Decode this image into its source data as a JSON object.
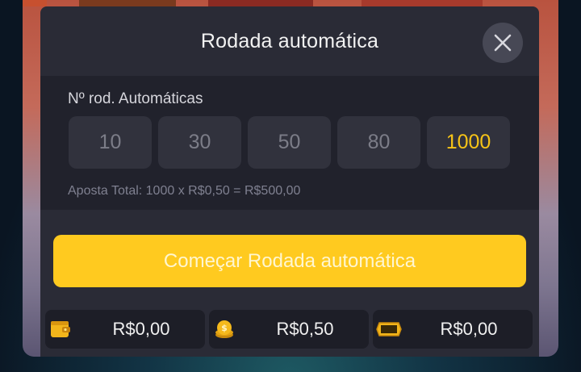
{
  "modal": {
    "title": "Rodada automática",
    "close_icon": "close-icon"
  },
  "autospin": {
    "label": "Nº rod. Automáticas",
    "options": [
      "10",
      "30",
      "50",
      "80",
      "1000"
    ],
    "selected": "1000",
    "total_text": "Aposta Total: 1000 x R$0,50 = R$500,00"
  },
  "start_button": {
    "label": "Começar Rodada automática"
  },
  "stats": {
    "balance": {
      "icon": "wallet-icon",
      "value": "R$0,00"
    },
    "bet": {
      "icon": "coins-icon",
      "value": "R$0,50"
    },
    "win": {
      "icon": "win-badge-icon",
      "value": "R$0,00"
    }
  },
  "colors": {
    "accent": "#ffca1f",
    "selected_text": "#f7c417",
    "panel": "#2a2b36"
  }
}
